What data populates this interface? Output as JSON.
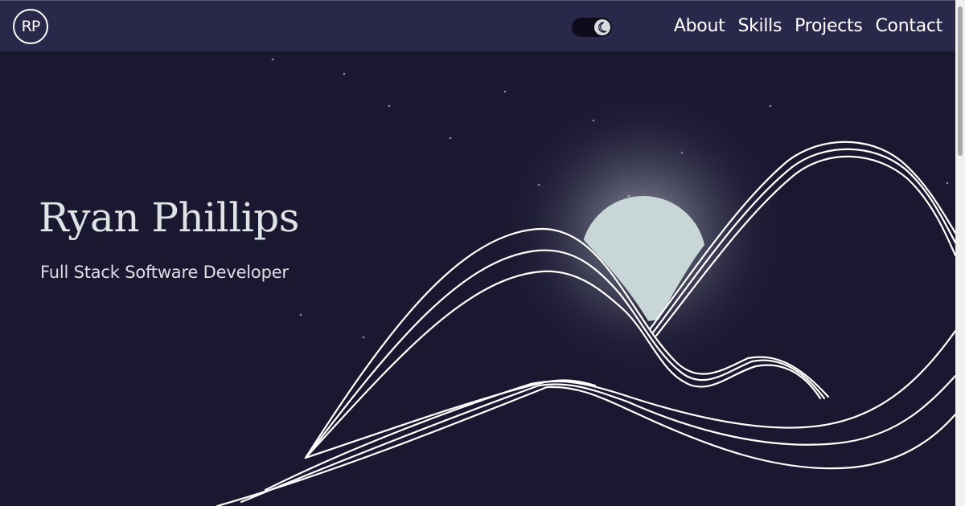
{
  "nav": {
    "logo_text": "RP",
    "links": [
      "About",
      "Skills",
      "Projects",
      "Contact"
    ]
  },
  "hero": {
    "name": "Ryan Phillips",
    "subtitle": "Full Stack Software Developer"
  },
  "colors": {
    "page_background": "#1a1830",
    "nav_background": "#2a284a",
    "moon": "#c9d6d8",
    "lines": "#ffffff",
    "text": "#dfe3e6"
  }
}
